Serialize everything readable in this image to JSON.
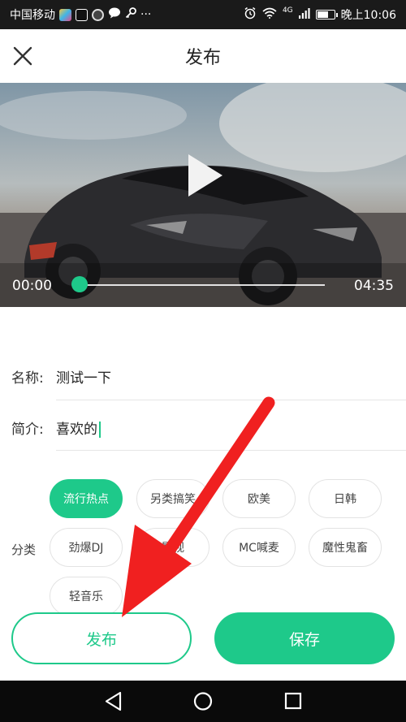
{
  "status_bar": {
    "carrier": "中国移动",
    "more": "···",
    "network": "4G",
    "time": "晚上10:06",
    "battery_level": 0.7
  },
  "header": {
    "title": "发布",
    "close_icon": "close-icon"
  },
  "video": {
    "current_time": "00:00",
    "total_time": "04:35",
    "progress": 0.0,
    "play_icon": "play-icon"
  },
  "form": {
    "name_label": "名称:",
    "name_value": "测试一下",
    "intro_label": "简介:",
    "intro_value": "喜欢的",
    "category_label": "分类",
    "categories": [
      {
        "label": "流行热点",
        "selected": true
      },
      {
        "label": "另类搞笑",
        "selected": false
      },
      {
        "label": "欧美",
        "selected": false
      },
      {
        "label": "日韩",
        "selected": false
      },
      {
        "label": "劲爆DJ",
        "selected": false
      },
      {
        "label": "影视",
        "selected": false
      },
      {
        "label": "MC喊麦",
        "selected": false
      },
      {
        "label": "魔性鬼畜",
        "selected": false
      },
      {
        "label": "轻音乐",
        "selected": false
      }
    ]
  },
  "actions": {
    "publish_label": "发布",
    "save_label": "保存"
  },
  "colors": {
    "accent": "#1ec98a",
    "annotation_arrow": "#f02020"
  }
}
